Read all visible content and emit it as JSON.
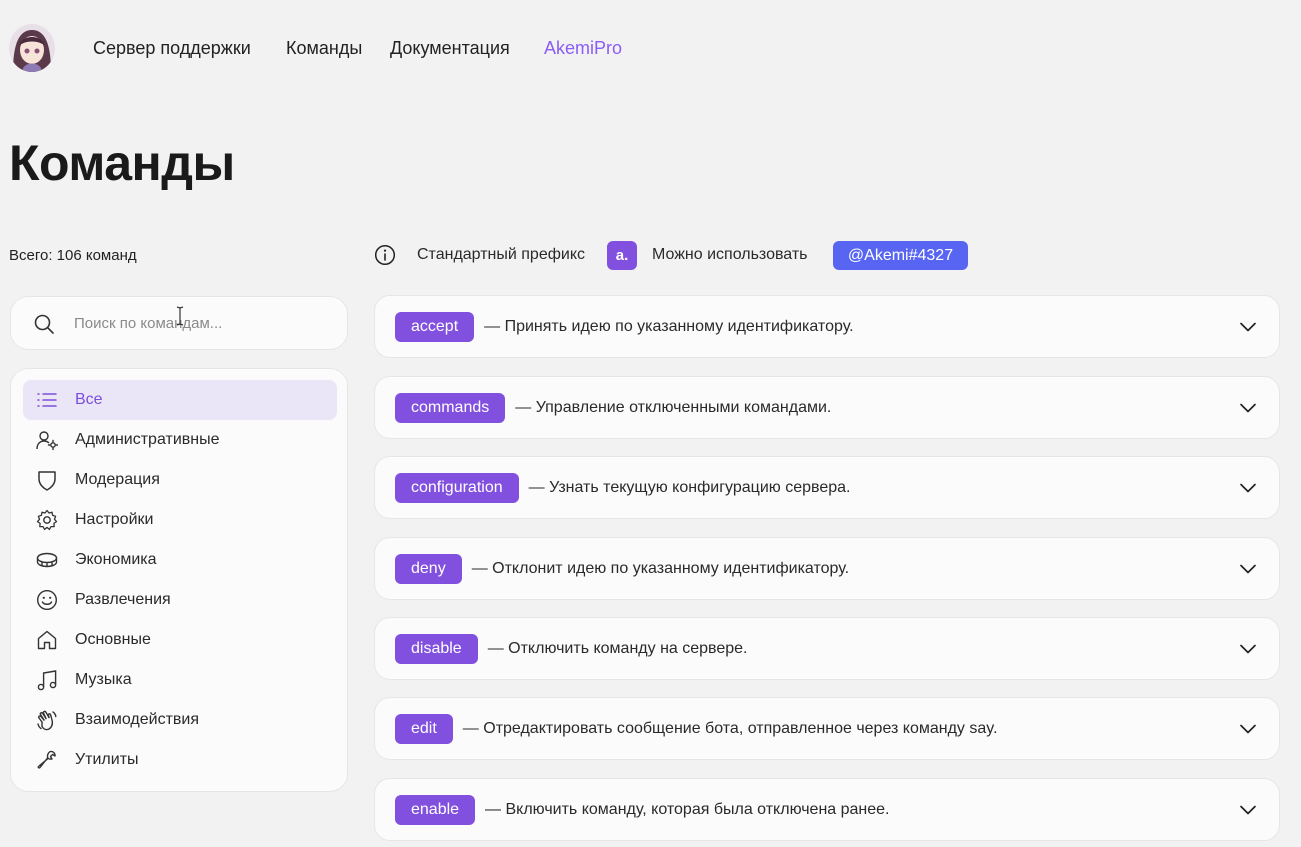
{
  "nav": {
    "links": [
      {
        "label": "Сервер поддержки"
      },
      {
        "label": "Команды"
      },
      {
        "label": "Документация"
      },
      {
        "label": "AkemiPro"
      }
    ]
  },
  "page": {
    "title": "Команды",
    "total": "Всего: 106 команд"
  },
  "search": {
    "placeholder": "Поиск по командам..."
  },
  "categories": [
    {
      "label": "Все",
      "icon": "list-icon",
      "active": true
    },
    {
      "label": "Административные",
      "icon": "user-gear-icon"
    },
    {
      "label": "Модерация",
      "icon": "shield-icon"
    },
    {
      "label": "Настройки",
      "icon": "gear-icon"
    },
    {
      "label": "Экономика",
      "icon": "coin-icon"
    },
    {
      "label": "Развлечения",
      "icon": "smile-icon"
    },
    {
      "label": "Основные",
      "icon": "home-icon"
    },
    {
      "label": "Музыка",
      "icon": "music-icon"
    },
    {
      "label": "Взаимодействия",
      "icon": "hand-wave-icon"
    },
    {
      "label": "Утилиты",
      "icon": "wrench-icon"
    }
  ],
  "info": {
    "prefix_label": "Стандартный префикс",
    "prefix": "a.",
    "alt_label": "Можно использовать",
    "mention": "@Akemi#4327"
  },
  "commands": [
    {
      "name": "accept",
      "desc": "—  Принять идею по указанному идентификатору."
    },
    {
      "name": "commands",
      "desc": "—  Управление отключенными командами."
    },
    {
      "name": "configuration",
      "desc": "—  Узнать текущую конфигурацию сервера."
    },
    {
      "name": "deny",
      "desc": "—  Отклонит идею по указанному идентификатору."
    },
    {
      "name": "disable",
      "desc": "—  Отключить команду на сервере."
    },
    {
      "name": "edit",
      "desc": "—  Отредактировать сообщение бота, отправленное через команду say."
    },
    {
      "name": "enable",
      "desc": "—  Включить команду, которая была отключена ранее."
    }
  ],
  "colors": {
    "accent": "#8250df",
    "mention": "#5865f2",
    "active_bg": "#ebe6f7"
  }
}
